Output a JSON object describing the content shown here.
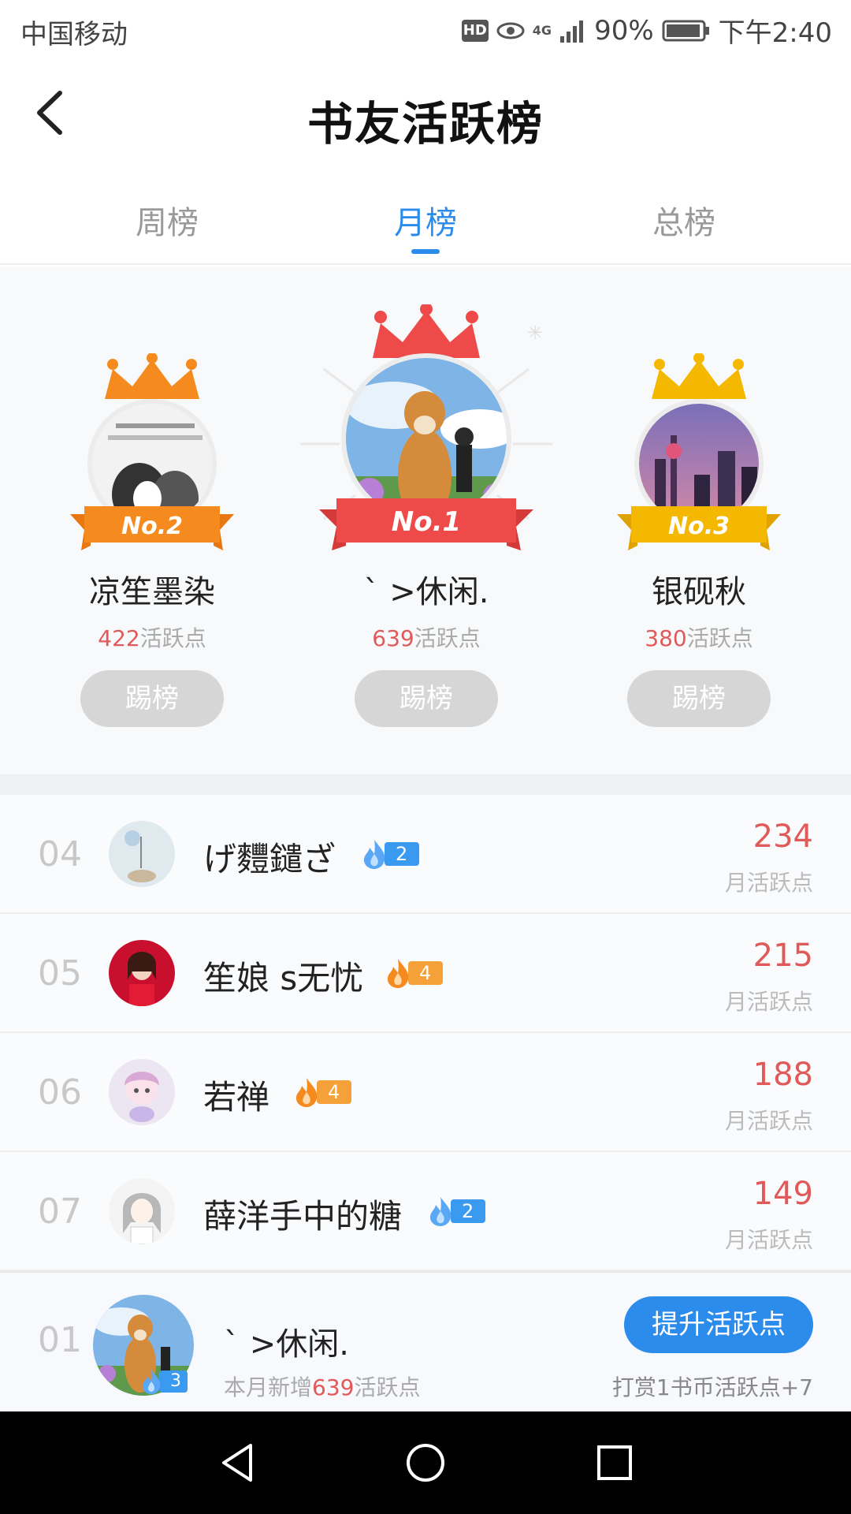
{
  "status_bar": {
    "carrier": "中国移动",
    "hd": "HD",
    "network": "4G",
    "battery": "90%",
    "time": "下午2:40"
  },
  "header": {
    "title": "书友活跃榜"
  },
  "tabs": [
    {
      "label": "周榜",
      "active": false
    },
    {
      "label": "月榜",
      "active": true
    },
    {
      "label": "总榜",
      "active": false
    }
  ],
  "podium": {
    "kick_label": "踢榜",
    "points_suffix": "活跃点",
    "first": {
      "badge": "No.1",
      "name": "ˋ >休闲.",
      "points": "639"
    },
    "second": {
      "badge": "No.2",
      "name": "凉笙墨染",
      "points": "422"
    },
    "third": {
      "badge": "No.3",
      "name": "银砚秋",
      "points": "380"
    }
  },
  "list": {
    "points_label": "月活跃点",
    "items": [
      {
        "rank": "04",
        "name": "げ麷鑓ざ",
        "level": "2",
        "level_color": "#3a9af0",
        "points": "234"
      },
      {
        "rank": "05",
        "name": "笙娘 s无忧",
        "level": "4",
        "level_color": "#f5a13a",
        "points": "215"
      },
      {
        "rank": "06",
        "name": "若禅",
        "level": "4",
        "level_color": "#f5a13a",
        "points": "188"
      },
      {
        "rank": "07",
        "name": "薛洋手中的糖",
        "level": "2",
        "level_color": "#3a9af0",
        "points": "149"
      }
    ]
  },
  "my_rank": {
    "rank": "01",
    "name": "ˋ >休闲.",
    "level": "3",
    "sub_prefix": "本月新增",
    "sub_points": "639",
    "sub_suffix": "活跃点",
    "boost_label": "提升活跃点",
    "hint": "打赏1书币活跃点+7"
  },
  "colors": {
    "accent": "#2b8cec",
    "points_red": "#e05a5a",
    "gold": "#f5b800",
    "silver_orange": "#f58a1f",
    "crown_red": "#ee4a4a"
  }
}
